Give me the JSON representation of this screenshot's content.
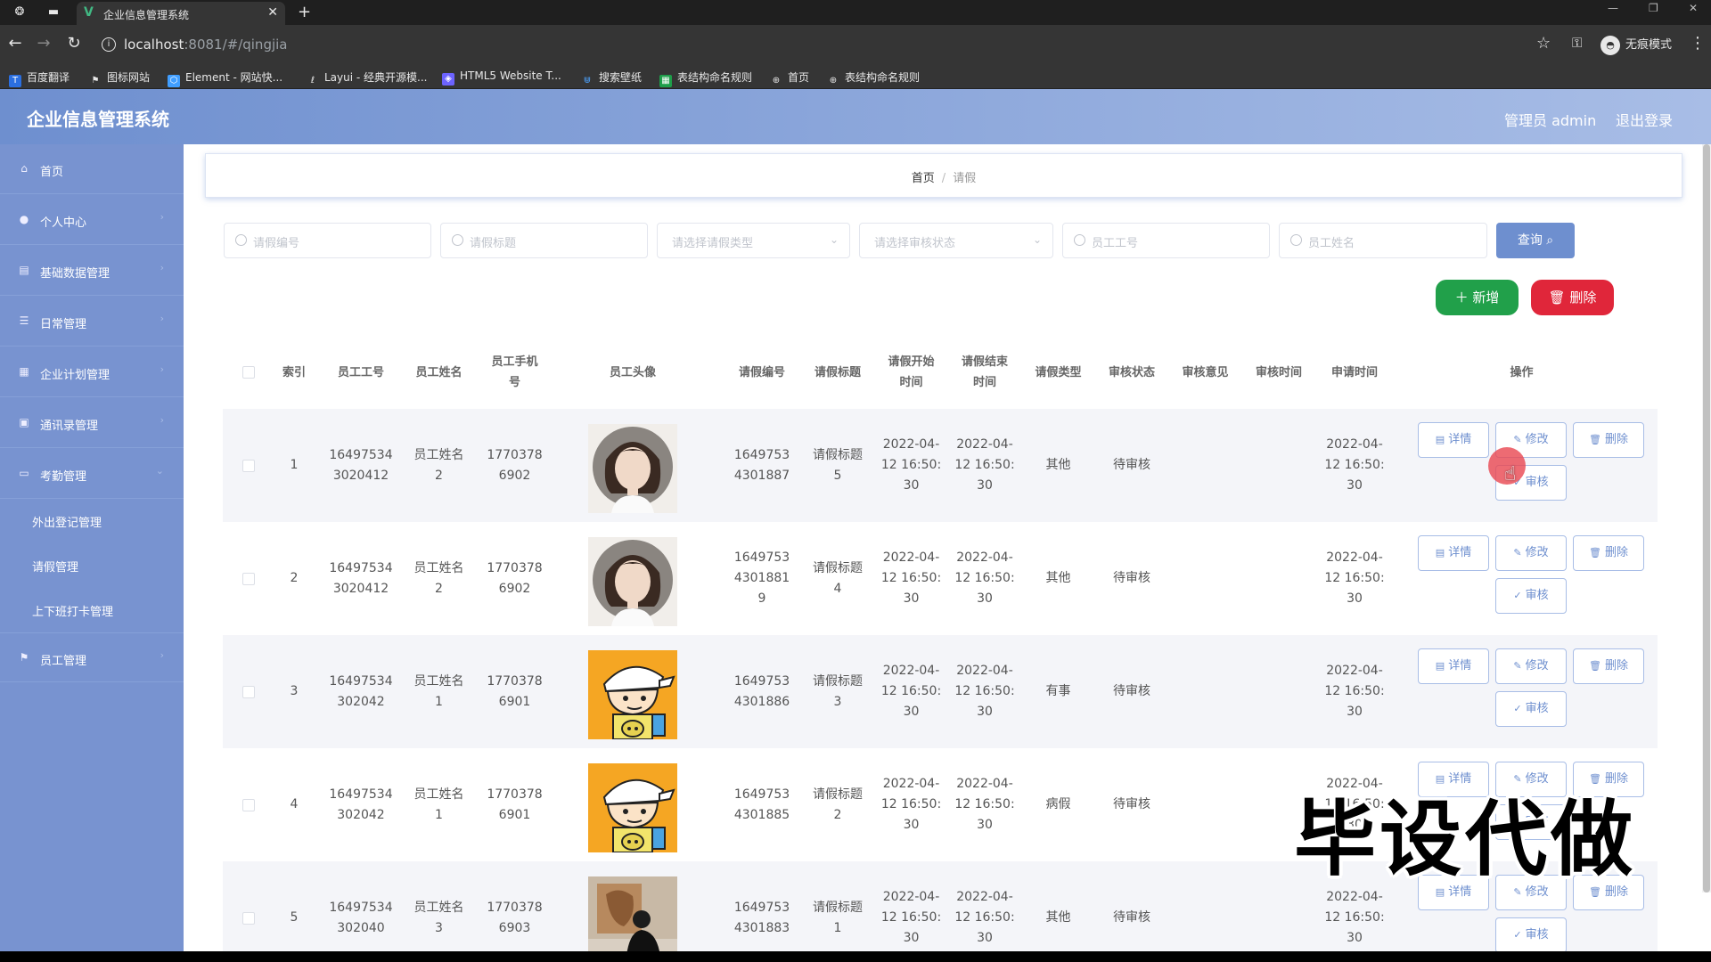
{
  "browser": {
    "tab_title": "企业信息管理系统",
    "url_host": "localhost",
    "url_rest": ":8081/#/qingjia",
    "incognito_label": "无痕模式",
    "bookmarks": [
      "百度翻译",
      "图标网站",
      "Element - 网站快...",
      "Layui - 经典开源模...",
      "HTML5 Website T...",
      "搜索壁纸",
      "表结构命名规则",
      "首页",
      "表结构命名规则"
    ]
  },
  "header": {
    "title": "企业信息管理系统",
    "admin": "管理员 admin",
    "logout": "退出登录"
  },
  "sidebar": {
    "items": [
      {
        "label": "首页",
        "icon": "home-icon"
      },
      {
        "label": "个人中心",
        "icon": "user-icon"
      },
      {
        "label": "基础数据管理",
        "icon": "database-icon"
      },
      {
        "label": "日常管理",
        "icon": "list-icon"
      },
      {
        "label": "企业计划管理",
        "icon": "plan-icon"
      },
      {
        "label": "通讯录管理",
        "icon": "contacts-icon"
      },
      {
        "label": "考勤管理",
        "icon": "attendance-icon"
      }
    ],
    "sub_items": [
      "外出登记管理",
      "请假管理",
      "上下班打卡管理"
    ],
    "last_item": {
      "label": "员工管理",
      "icon": "flag-icon"
    }
  },
  "breadcrumb": {
    "home": "首页",
    "current": "请假"
  },
  "search": {
    "leave_no_placeholder": "请假编号",
    "leave_title_placeholder": "请假标题",
    "leave_type_placeholder": "请选择请假类型",
    "audit_status_placeholder": "请选择审核状态",
    "employee_no_placeholder": "员工工号",
    "employee_name_placeholder": "员工姓名",
    "query_label": "查询"
  },
  "toolbar": {
    "add_label": "新增",
    "delete_label": "删除"
  },
  "table": {
    "headers": {
      "index": "索引",
      "emp_no": "员工工号",
      "emp_name": "员工姓名",
      "emp_phone_1": "员工手机",
      "emp_phone_2": "号",
      "emp_avatar": "员工头像",
      "leave_no": "请假编号",
      "leave_title": "请假标题",
      "start_1": "请假开始",
      "start_2": "时间",
      "end_1": "请假结束",
      "end_2": "时间",
      "leave_type": "请假类型",
      "audit_status": "审核状态",
      "audit_opinion": "审核意见",
      "audit_time": "审核时间",
      "apply_time": "申请时间",
      "actions": "操作"
    },
    "rows": [
      {
        "index": "1",
        "emp_no_1": "16497534",
        "emp_no_2": "3020412",
        "emp_name_1": "员工姓名",
        "emp_name_2": "2",
        "phone_1": "1770378",
        "phone_2": "6902",
        "avatar": "avatar-woman",
        "leave_no_1": "1649753",
        "leave_no_2": "4301887",
        "leave_no_3": "",
        "title_1": "请假标题",
        "title_2": "5",
        "start_1": "2022-04-",
        "start_2": "12 16:50:",
        "start_3": "30",
        "end_1": "2022-04-",
        "end_2": "12 16:50:",
        "end_3": "30",
        "type": "其他",
        "status": "待审核",
        "opinion": "",
        "audit_time": "",
        "apply_1": "2022-04-",
        "apply_2": "12 16:50:",
        "apply_3": "30"
      },
      {
        "index": "2",
        "emp_no_1": "16497534",
        "emp_no_2": "3020412",
        "emp_name_1": "员工姓名",
        "emp_name_2": "2",
        "phone_1": "1770378",
        "phone_2": "6902",
        "avatar": "avatar-woman",
        "leave_no_1": "1649753",
        "leave_no_2": "4301881",
        "leave_no_3": "9",
        "title_1": "请假标题",
        "title_2": "4",
        "start_1": "2022-04-",
        "start_2": "12 16:50:",
        "start_3": "30",
        "end_1": "2022-04-",
        "end_2": "12 16:50:",
        "end_3": "30",
        "type": "其他",
        "status": "待审核",
        "opinion": "",
        "audit_time": "",
        "apply_1": "2022-04-",
        "apply_2": "12 16:50:",
        "apply_3": "30"
      },
      {
        "index": "3",
        "emp_no_1": "16497534",
        "emp_no_2": "302042",
        "emp_name_1": "员工姓名",
        "emp_name_2": "1",
        "phone_1": "1770378",
        "phone_2": "6901",
        "avatar": "avatar-cartoon",
        "leave_no_1": "1649753",
        "leave_no_2": "4301886",
        "leave_no_3": "",
        "title_1": "请假标题",
        "title_2": "3",
        "start_1": "2022-04-",
        "start_2": "12 16:50:",
        "start_3": "30",
        "end_1": "2022-04-",
        "end_2": "12 16:50:",
        "end_3": "30",
        "type": "有事",
        "status": "待审核",
        "opinion": "",
        "audit_time": "",
        "apply_1": "2022-04-",
        "apply_2": "12 16:50:",
        "apply_3": "30"
      },
      {
        "index": "4",
        "emp_no_1": "16497534",
        "emp_no_2": "302042",
        "emp_name_1": "员工姓名",
        "emp_name_2": "1",
        "phone_1": "1770378",
        "phone_2": "6901",
        "avatar": "avatar-cartoon",
        "leave_no_1": "1649753",
        "leave_no_2": "4301885",
        "leave_no_3": "",
        "title_1": "请假标题",
        "title_2": "2",
        "start_1": "2022-04-",
        "start_2": "12 16:50:",
        "start_3": "30",
        "end_1": "2022-04-",
        "end_2": "12 16:50:",
        "end_3": "30",
        "type": "病假",
        "status": "待审核",
        "opinion": "",
        "audit_time": "",
        "apply_1": "2022-04-",
        "apply_2": "12 16:50:",
        "apply_3": "30"
      },
      {
        "index": "5",
        "emp_no_1": "16497534",
        "emp_no_2": "302040",
        "emp_name_1": "员工姓名",
        "emp_name_2": "3",
        "phone_1": "1770378",
        "phone_2": "6903",
        "avatar": "avatar-photo",
        "leave_no_1": "1649753",
        "leave_no_2": "4301883",
        "leave_no_3": "",
        "title_1": "请假标题",
        "title_2": "1",
        "start_1": "2022-04-",
        "start_2": "12 16:50:",
        "start_3": "30",
        "end_1": "2022-04-",
        "end_2": "12 16:50:",
        "end_3": "30",
        "type": "其他",
        "status": "待审核",
        "opinion": "",
        "audit_time": "",
        "apply_1": "2022-04-",
        "apply_2": "12 16:50:",
        "apply_3": "30"
      }
    ],
    "actions": {
      "detail": "详情",
      "edit": "修改",
      "delete": "删除",
      "audit": "审核"
    }
  },
  "watermark": "毕设代做",
  "colors": {
    "primary": "#6e8fcf",
    "sidebar": "#7893d0",
    "success": "#21a04a",
    "danger": "#e0263a"
  }
}
